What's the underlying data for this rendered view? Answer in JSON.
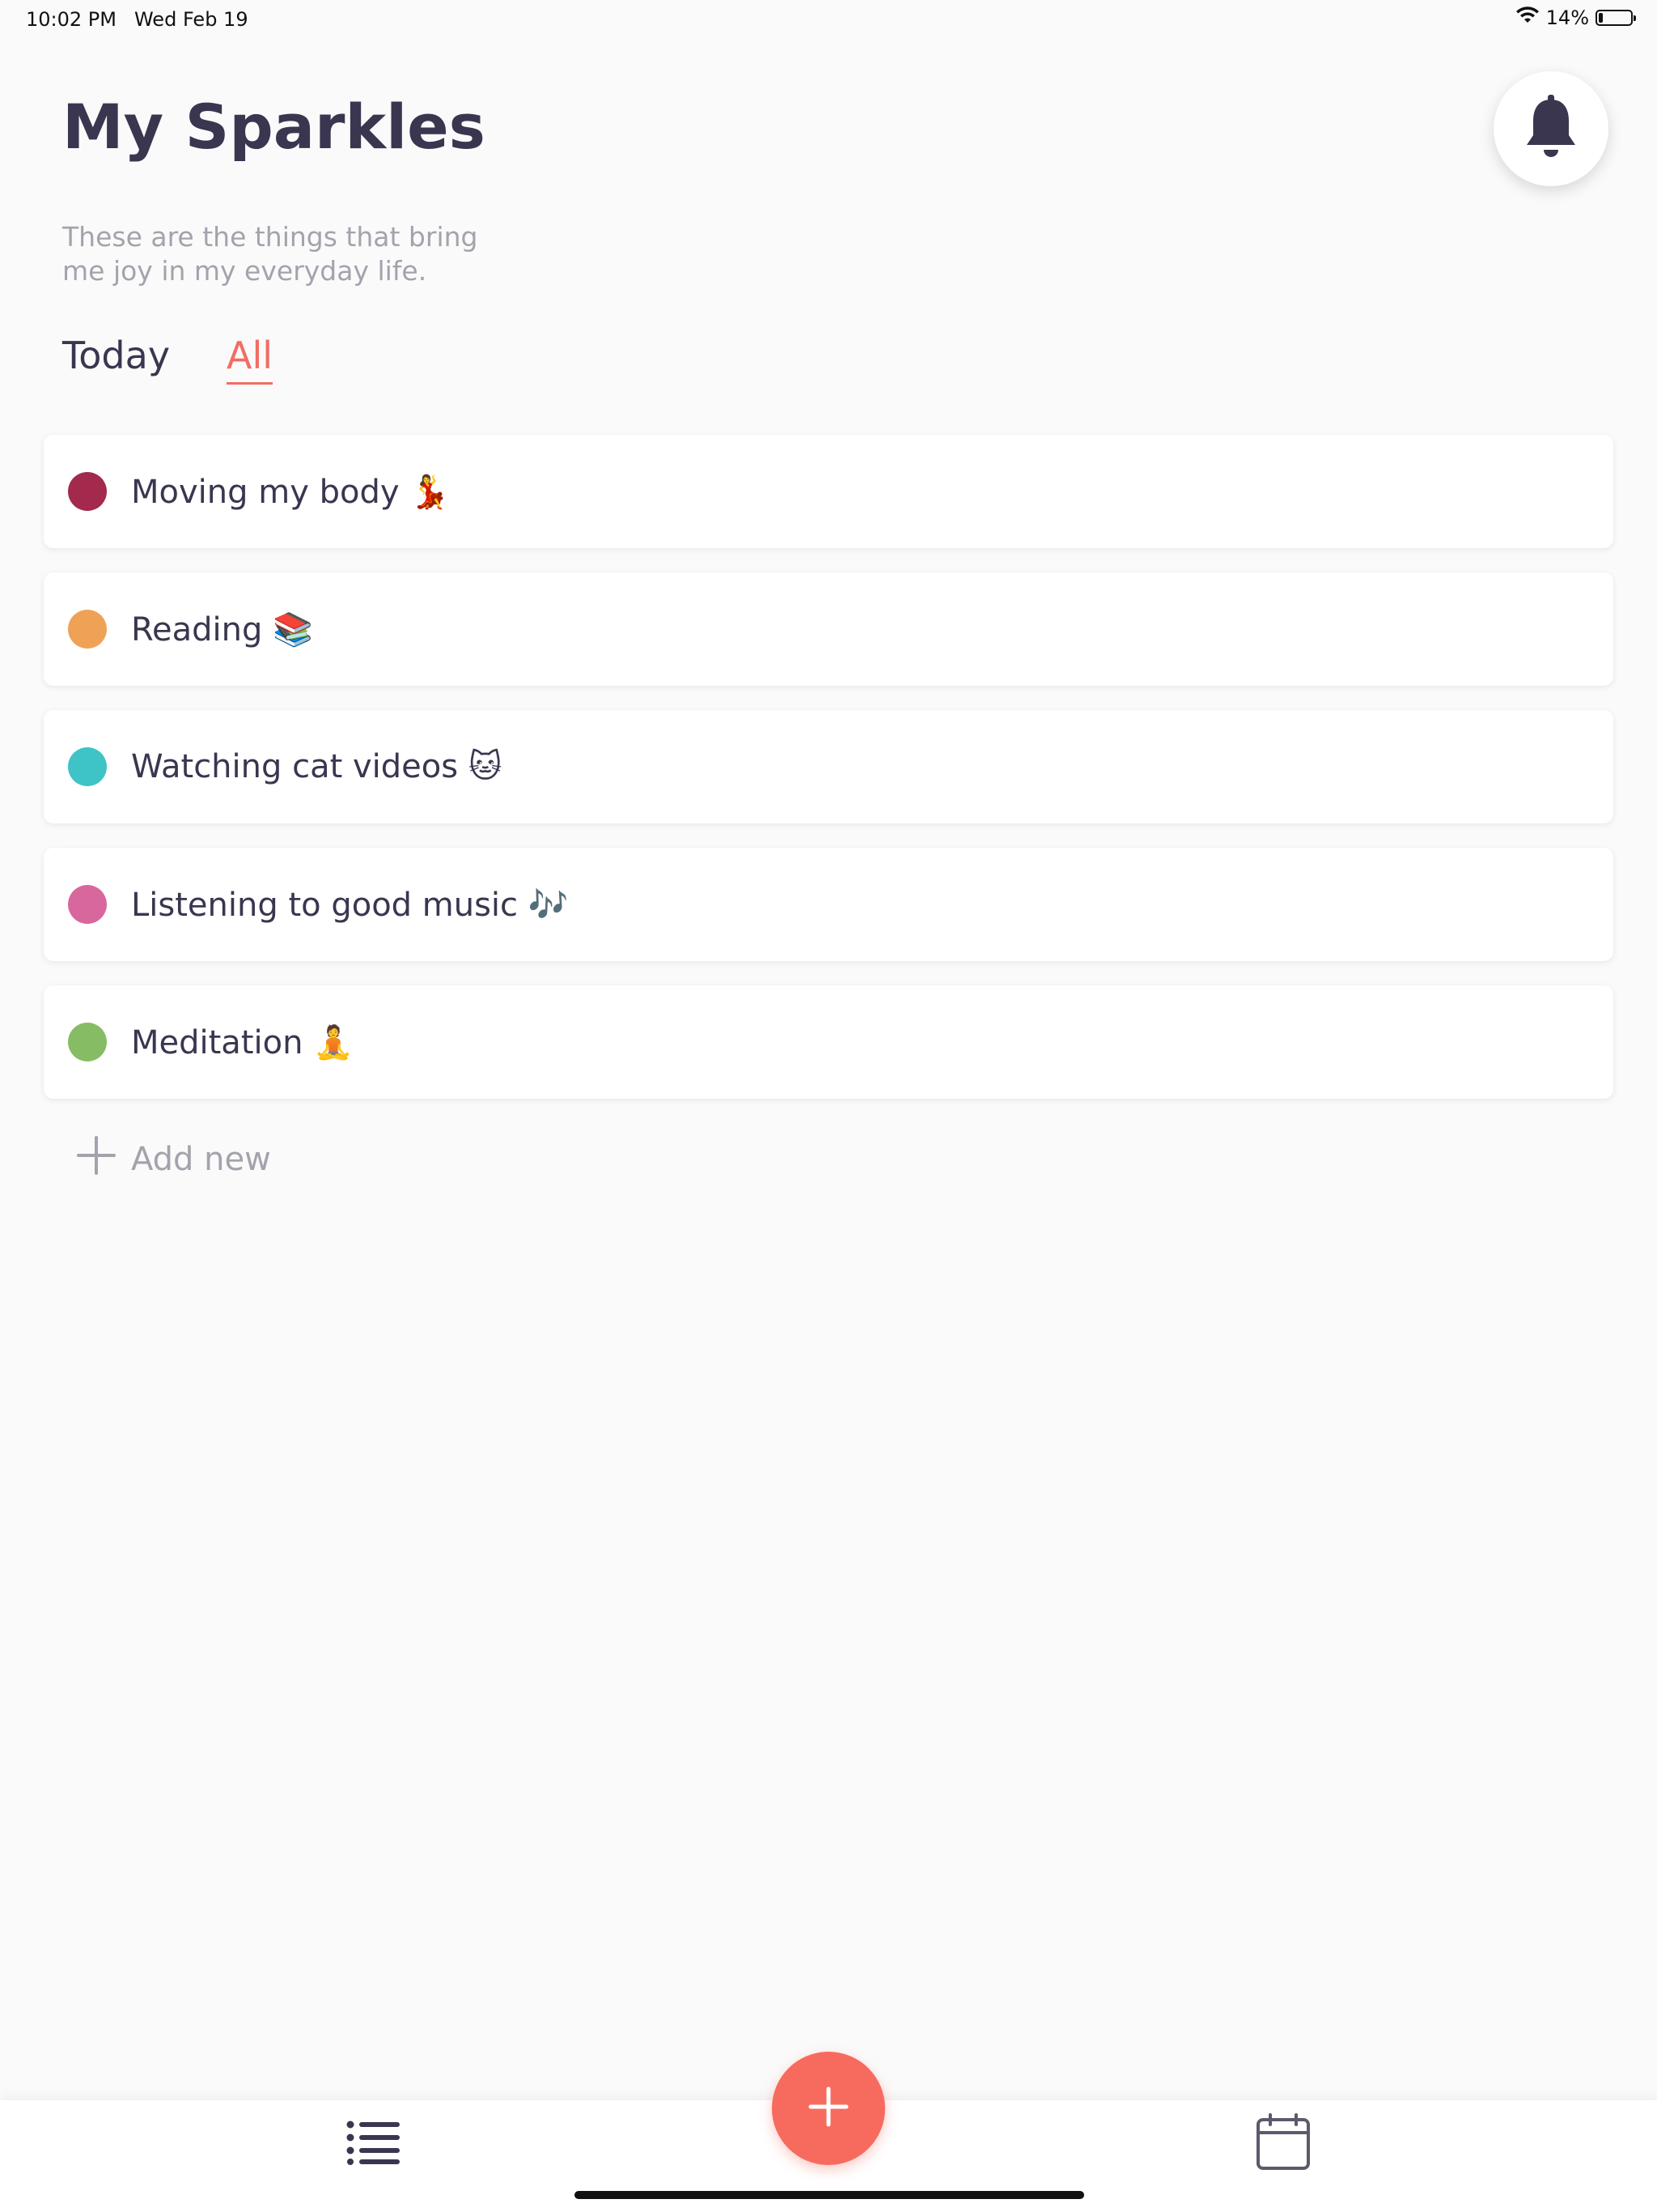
{
  "status_bar": {
    "time": "10:02 PM",
    "date": "Wed Feb 19",
    "battery": "14%",
    "battery_level": 0.14
  },
  "header": {
    "title": "My Sparkles",
    "subtitle": "These are the things that bring me joy in my everyday life."
  },
  "tabs": [
    {
      "label": "Today",
      "active": false
    },
    {
      "label": "All",
      "active": true
    }
  ],
  "items": [
    {
      "label": "Moving my body 💃",
      "color": "#a3294d"
    },
    {
      "label": "Reading 📚",
      "color": "#efa255"
    },
    {
      "label": "Watching cat videos 🐱",
      "color": "#3ec3c6"
    },
    {
      "label": "Listening to good music 🎶",
      "color": "#d8679d"
    },
    {
      "label": "Meditation 🧘",
      "color": "#86bd64"
    }
  ],
  "add_new_label": "Add new",
  "colors": {
    "accent": "#f26d63",
    "fab": "#f76b5e",
    "text": "#3a3650",
    "muted": "#a3a3ad"
  },
  "icons": {
    "bell": "bell-icon",
    "wifi": "wifi-icon",
    "battery": "battery-icon",
    "plus": "plus-icon",
    "list": "list-icon",
    "calendar": "calendar-icon"
  }
}
